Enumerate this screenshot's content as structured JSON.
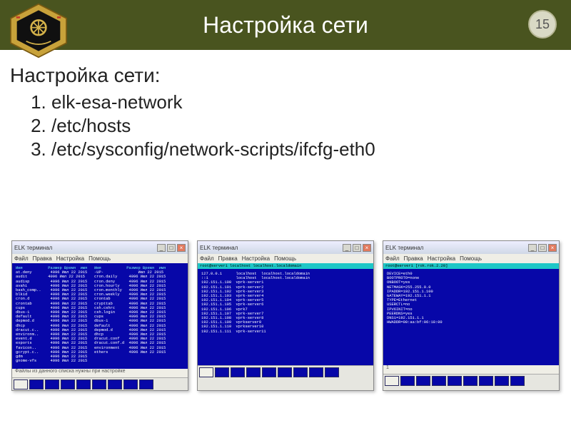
{
  "header": {
    "title": "Настройка сети",
    "page_number": "15"
  },
  "body": {
    "subtitle": "Настройка сети:",
    "items": [
      "elk-esa-network",
      "/etc/hosts",
      "/etc/sysconfig/network-scripts/ifcfg-eth0"
    ]
  },
  "windows": {
    "app_title": "ELK терминал",
    "menu": {
      "file": "Файл",
      "edit": "Правка",
      "settings": "Настройка",
      "help": "Помощь"
    },
    "btn_min": "_",
    "btn_max": "□",
    "btn_close": "×",
    "status": "1"
  },
  "terminal1": {
    "header_left": "Имя           Размер Время  имя",
    "header_right": "Имя           Размер Время  имя",
    "rows_left": [
      "at.deny        4096 Июл 22 2015",
      "audit         4096 Июл 22 2015",
      "audisp         4096 Июл 22 2015",
      "avahi          4096 Июл 22 2015",
      "bash_comp..    4096 Июл 22 2015",
      "blkid          4096 Июл 22 2015",
      "cron.d         4096 Июл 22 2015",
      "crontab        4096 Июл 22 2015",
      "cups           4096 Июл 22 2015",
      "dbus-1         4096 Июл 22 2015",
      "default        4096 Июл 22 2015",
      "depmod.d       4096 Июл 22 2015",
      "dhcp           4096 Июл 22 2015",
      "dracut.c..     4096 Июл 22 2015",
      "environm..     4096 Июл 22 2015",
      "event.d        4096 Июл 22 2015",
      "exports        4096 Июл 22 2015",
      "favicon..      4096 Июл 22 2015",
      "gcrypt.c..     4096 Июл 22 2015",
      "gdm            4096 Июл 22 2015",
      "gnome-vfs      4096 Июл 22 2015"
    ],
    "rows_right": [
      "-UP-               Июл 22 2015",
      "cron.daily     4096 Июл 22 2015",
      "cron.deny      4096 Июл 22 2015",
      "cron.hourly    4096 Июл 22 2015",
      "cron.monthly   4096 Июл 22 2015",
      "cron.weekly    4096 Июл 22 2015",
      "crontab        4096 Июл 22 2015",
      "crypttab       4096 Июл 22 2015",
      "csh.cshrc      4096 Июл 22 2015",
      "csh.login      4096 Июл 22 2015",
      "cups           4096 Июл 22 2015",
      "dbus-1         4096 Июл 22 2015",
      "default        4096 Июл 22 2015",
      "depmod.d       4096 Июл 22 2015",
      "dhcp           4096 Июл 22 2015",
      "dracut.conf    4096 Июл 22 2015",
      "dracut.conf.d  4096 Июл 22 2015",
      "environment    4096 Июл 22 2015",
      "ethers         4096 Июл 22 2015"
    ],
    "footer": "Файлы из данного списка нужны при настройке"
  },
  "terminal2": {
    "head": "root@server1                    localhost  localhost.localdomain",
    "lines": [
      "127.0.0.1      localhost  localhost.localdomain",
      "::1            localhost  localhost.localdomain",
      "192.151.1.100  vprk-server1",
      "192.151.1.101  vprk-server2",
      "192.151.1.102  vprk-server3",
      "192.151.1.103  vprk-server4",
      "192.151.1.104  vprk-server5",
      "192.151.1.105  vprk-server6",
      "192.151.1.106  vprk7",
      "192.151.1.107  vprk-server7",
      "192.151.1.108  vprk-server8",
      "192.151.1.109  vprkserver9",
      "192.151.1.110  vprkserver10",
      "192.151.1.111  vprk-server11"
    ]
  },
  "terminal3": {
    "head": "root@server1                    [rok.rok.2.20]",
    "lines": [
      "DEVICE=eth0",
      "BOOTPROTO=none",
      "ONBOOT=yes",
      "NETMASK=255.255.0.0",
      "IPADDR=192.151.1.100",
      "GATEWAY=192.151.1.1",
      "TYPE=Ethernet",
      "USERCTL=no",
      "IPV6INIT=no",
      "PEERDNS=yes",
      "DNS1=192.151.1.1",
      "HWADDR=00:aa:bf:06:18:00"
    ]
  }
}
